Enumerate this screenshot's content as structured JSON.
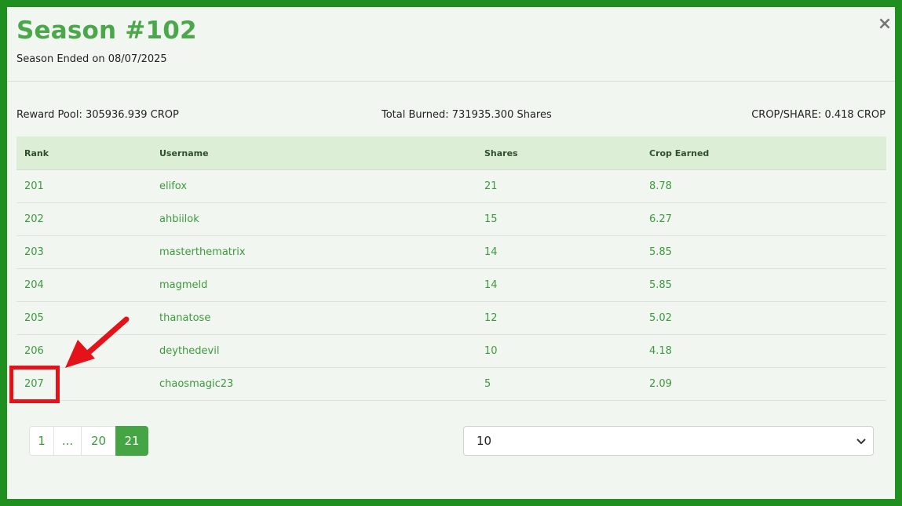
{
  "modal": {
    "title": "Season #102",
    "subtitle": "Season Ended on 08/07/2025",
    "close_icon": "close-icon"
  },
  "stats": {
    "reward_pool": "Reward Pool: 305936.939 CROP",
    "total_burned": "Total Burned: 731935.300 Shares",
    "crop_per_share": "CROP/SHARE: 0.418 CROP"
  },
  "table": {
    "headers": [
      "Rank",
      "Username",
      "Shares",
      "Crop Earned"
    ],
    "rows": [
      [
        "201",
        "elifox",
        "21",
        "8.78"
      ],
      [
        "202",
        "ahbiilok",
        "15",
        "6.27"
      ],
      [
        "203",
        "masterthematrix",
        "14",
        "5.85"
      ],
      [
        "204",
        "magmeld",
        "14",
        "5.85"
      ],
      [
        "205",
        "thanatose",
        "12",
        "5.02"
      ],
      [
        "206",
        "deythedevil",
        "10",
        "4.18"
      ],
      [
        "207",
        "chaosmagic23",
        "5",
        "2.09"
      ]
    ]
  },
  "pagination": {
    "items": [
      "1",
      "...",
      "20",
      "21"
    ],
    "active": "21"
  },
  "page_size_select": {
    "value": "10",
    "icon": "chevron-down-icon"
  },
  "annotation": {
    "highlight_color": "#e4131a",
    "arrow_icon": "arrow-icon"
  },
  "colors": {
    "accent": "#45a545",
    "frame": "#1f8f1f",
    "header_row": "#dcefd6"
  }
}
